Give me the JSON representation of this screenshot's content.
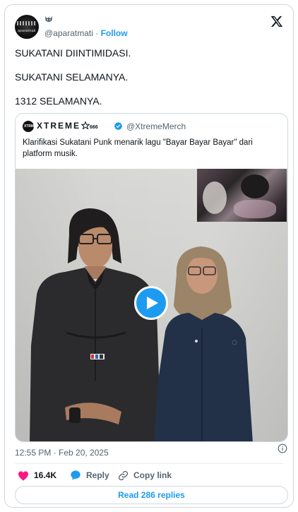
{
  "author": {
    "handle": "@aparatmati",
    "follow_label": "Follow",
    "avatar_text": "aparatmati"
  },
  "tweet": {
    "lines": [
      "SUKATANI DIINTIMIDASI.",
      "SUKATANI SELAMANYA.",
      "1312 SELAMANYA."
    ]
  },
  "quote": {
    "avatar_text": "XTRM",
    "display_name": "XTREME",
    "name_suffix": "666",
    "handle": "@XtremeMerch",
    "text": "Klarifikasi Sukatani Punk menarik lagu \"Bayar Bayar Bayar\" dari platform musik."
  },
  "video": {
    "play_icon": "play-icon",
    "shirt_patch": "▮▮▮"
  },
  "meta": {
    "timestamp": "12:55 PM · Feb 20, 2025"
  },
  "actions": {
    "like_count": "16.4K",
    "reply_label": "Reply",
    "copy_label": "Copy link"
  },
  "read_replies_label": "Read 286 replies",
  "colors": {
    "accent": "#1d9bf0",
    "like": "#f91880",
    "text_secondary": "#536471"
  }
}
